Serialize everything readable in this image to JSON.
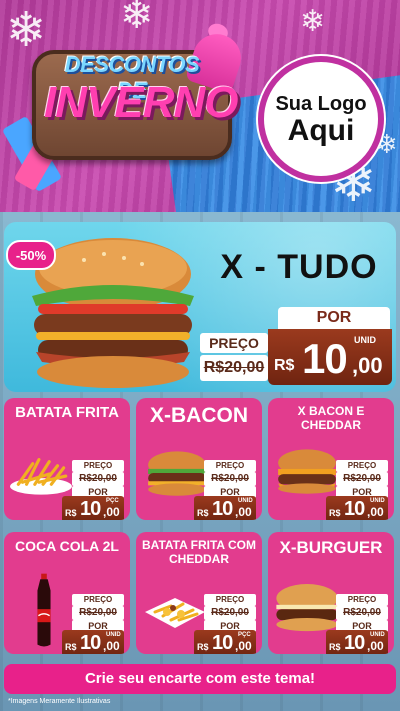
{
  "header": {
    "title_line1": "DESCONTOS DE",
    "title_line2": "INVERNO",
    "logo_line1": "Sua Logo",
    "logo_line2": "Aqui"
  },
  "hero": {
    "discount": "-50%",
    "name": "X - TUDO",
    "preco_label": "PREÇO",
    "old_price": "R$20,00",
    "por_label": "POR",
    "currency": "R$",
    "price_int": "10",
    "price_dec": ",00",
    "unit": "UNID"
  },
  "products": [
    {
      "name": "BATATA FRITA",
      "preco_label": "PREÇO",
      "old_price": "R$20,00",
      "por_label": "POR",
      "currency": "R$",
      "price_int": "10",
      "price_dec": ",00",
      "unit": "PÇC"
    },
    {
      "name": "X-BACON",
      "preco_label": "PREÇO",
      "old_price": "R$20,00",
      "por_label": "POR",
      "currency": "R$",
      "price_int": "10",
      "price_dec": ",00",
      "unit": "UNID"
    },
    {
      "name": "X BACON E CHEDDAR",
      "preco_label": "PREÇO",
      "old_price": "R$20,00",
      "por_label": "POR",
      "currency": "R$",
      "price_int": "10",
      "price_dec": ",00",
      "unit": "UNID"
    },
    {
      "name": "COCA COLA 2L",
      "preco_label": "PREÇO",
      "old_price": "R$20,00",
      "por_label": "POR",
      "currency": "R$",
      "price_int": "10",
      "price_dec": ",00",
      "unit": "UNID"
    },
    {
      "name": "BATATA FRITA COM CHEDDAR",
      "preco_label": "PREÇO",
      "old_price": "R$20,00",
      "por_label": "POR",
      "currency": "R$",
      "price_int": "10",
      "price_dec": ",00",
      "unit": "PÇC"
    },
    {
      "name": "X-BURGUER",
      "preco_label": "PREÇO",
      "old_price": "R$20,00",
      "por_label": "POR",
      "currency": "R$",
      "price_int": "10",
      "price_dec": ",00",
      "unit": "UNID"
    }
  ],
  "footer": {
    "cta": "Crie seu encarte com este tema!",
    "disclaimer": "*Imagens Meramente Ilustrativas"
  },
  "colors": {
    "pink": "#e23c8e",
    "brown": "#7a2a12",
    "cyan": "#4fc3e2",
    "purple": "#b23a9a"
  }
}
